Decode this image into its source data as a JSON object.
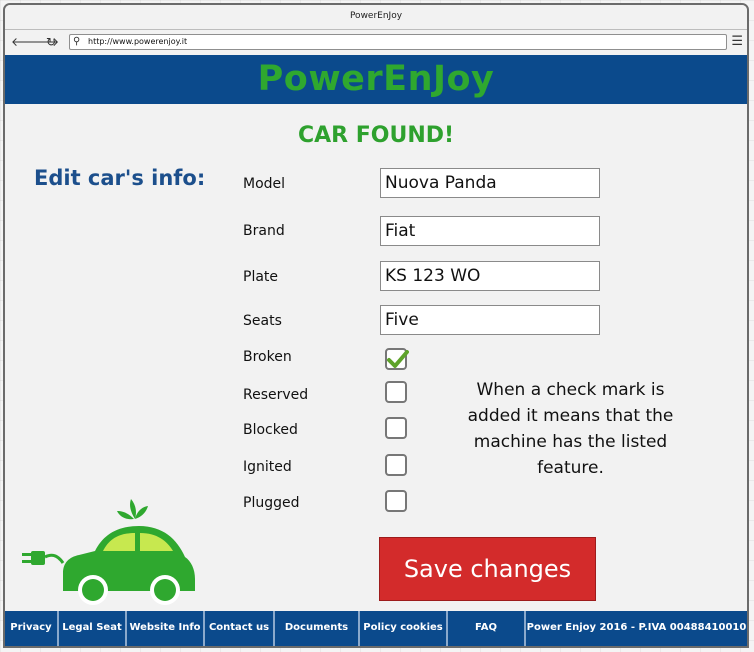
{
  "window": {
    "title": "PowerEnJoy"
  },
  "browser": {
    "back_icon": "back-arrow-icon",
    "forward_icon": "forward-arrow-icon",
    "refresh_icon": "refresh-icon",
    "url": "http://www.powerenjoy.it"
  },
  "header": {
    "logo_text": "PowerEnJoy"
  },
  "main": {
    "status_title": "CAR FOUND!",
    "edit_title": "Edit car's info:",
    "fields": [
      {
        "label": "Model",
        "value": "Nuova Panda"
      },
      {
        "label": "Brand",
        "value": "Fiat"
      },
      {
        "label": "Plate",
        "value": "KS 123 WO"
      },
      {
        "label": "Seats",
        "value": "Five"
      }
    ],
    "checkboxes": [
      {
        "label": "Broken",
        "checked": true
      },
      {
        "label": "Reserved",
        "checked": false
      },
      {
        "label": "Blocked",
        "checked": false
      },
      {
        "label": "Ignited",
        "checked": false
      },
      {
        "label": "Plugged",
        "checked": false
      }
    ],
    "note": "When a check mark is added it means that the machine has the listed feature.",
    "save_label": "Save changes"
  },
  "footer": {
    "links": [
      "Privacy",
      "Legal Seat",
      "Website Info",
      "Contact us",
      "Documents",
      "Policy cookies",
      "FAQ"
    ],
    "copyright": "Power Enjoy 2016 - P.IVA 00488410010"
  },
  "colors": {
    "header_bg": "#0b4a8c",
    "logo_green": "#2fa82f",
    "title_green": "#2ea12e",
    "edit_title_blue": "#1c4f8c",
    "save_button_red": "#d32b2b",
    "check_green": "#5ea32a"
  }
}
